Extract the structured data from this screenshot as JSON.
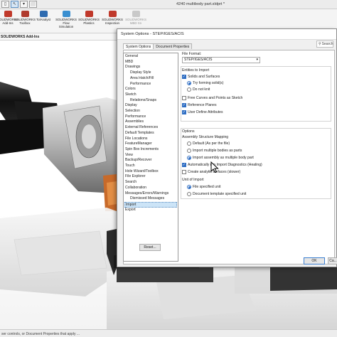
{
  "window": {
    "title": "4240 multibody part.sldprt *"
  },
  "toolbar": {
    "buttons": [
      "▯",
      "↖",
      "▾",
      "⬜"
    ]
  },
  "ribbon": {
    "items": [
      {
        "label": "SOLIDWORKS\nAdd-Ins",
        "color": "#c0392b"
      },
      {
        "label": "SOLIDWORKS\nToolbox",
        "color": "#b03a2e"
      },
      {
        "label": "TolAnalyst",
        "color": "#2e6bb0"
      },
      {
        "label": "SOLIDWORKS\nFlow\nSimulation",
        "color": "#3a8fd0"
      },
      {
        "label": "SOLIDWORKS\nPlastics",
        "color": "#c0392b"
      },
      {
        "label": "SOLIDWORKS\nInspection",
        "color": "#c0392b"
      },
      {
        "label": "SOLIDWORKS\nMBD Sn",
        "color": "#b5b5b5"
      }
    ]
  },
  "command_tab": {
    "label": "SOLIDWORKS Add-Ins"
  },
  "status_bar": {
    "text": "ser controls, or Document Properties that apply ..."
  },
  "dialog": {
    "title": "System Options - STEP/IGES/ACIS",
    "tabs": [
      "System Options",
      "Document Properties"
    ],
    "search_label": "Search",
    "categories": [
      {
        "label": "General",
        "level": 1
      },
      {
        "label": "MBD",
        "level": 1
      },
      {
        "label": "Drawings",
        "level": 1
      },
      {
        "label": "Display Style",
        "level": 2
      },
      {
        "label": "Area Hatch/Fill",
        "level": 2
      },
      {
        "label": "Performance",
        "level": 2
      },
      {
        "label": "Colors",
        "level": 1
      },
      {
        "label": "Sketch",
        "level": 1
      },
      {
        "label": "Relations/Snaps",
        "level": 2
      },
      {
        "label": "Display",
        "level": 1
      },
      {
        "label": "Selection",
        "level": 1
      },
      {
        "label": "Performance",
        "level": 1
      },
      {
        "label": "Assemblies",
        "level": 1
      },
      {
        "label": "External References",
        "level": 1
      },
      {
        "label": "Default Templates",
        "level": 1
      },
      {
        "label": "File Locations",
        "level": 1
      },
      {
        "label": "FeatureManager",
        "level": 1
      },
      {
        "label": "Spin Box Increments",
        "level": 1
      },
      {
        "label": "View",
        "level": 1
      },
      {
        "label": "Backup/Recover",
        "level": 1
      },
      {
        "label": "Touch",
        "level": 1
      },
      {
        "label": "Hole Wizard/Toolbox",
        "level": 1
      },
      {
        "label": "File Explorer",
        "level": 1
      },
      {
        "label": "Search",
        "level": 1
      },
      {
        "label": "Collaboration",
        "level": 1
      },
      {
        "label": "Messages/Errors/Warnings",
        "level": 1
      },
      {
        "label": "Dismissed Messages",
        "level": 2
      },
      {
        "label": "Import",
        "level": 1
      },
      {
        "label": "Export",
        "level": 1
      }
    ],
    "reset_label": "Reset...",
    "file_format_label": "File Format:",
    "file_format_value": "STEP/IGES/ACIS",
    "entities_group": {
      "title": "Entities to Import",
      "items": [
        {
          "label": "Solids and Surfaces",
          "type": "checkbox",
          "checked": true
        },
        {
          "label": "Try forming solid(s)",
          "type": "radio",
          "checked": true
        },
        {
          "label": "Do not knit",
          "type": "radio",
          "checked": false
        },
        {
          "label": "Free Curves and Points as Sketch",
          "type": "checkbox",
          "checked": false
        },
        {
          "label": "Reference Planes",
          "type": "checkbox",
          "checked": true
        },
        {
          "label": "User Define Attributes",
          "type": "checkbox",
          "checked": true
        }
      ]
    },
    "options_group": {
      "title": "Options",
      "assembly_mapping_label": "Assembly Structure Mapping",
      "mapping_items": [
        {
          "label": "Default (As per the file)",
          "checked": false
        },
        {
          "label": "Import multiple bodies as parts",
          "checked": false
        },
        {
          "label": "Import assembly as multiple body part",
          "checked": true
        }
      ],
      "check_items": [
        {
          "label": "Automatically run Import Diagnostics (Healing)",
          "checked": true
        },
        {
          "label": "Create analytic surfaces (slower)",
          "checked": false
        }
      ],
      "unit_label": "Unit of Import",
      "unit_items": [
        {
          "label": "File specified unit",
          "checked": true
        },
        {
          "label": "Document template specified unit",
          "checked": false
        }
      ]
    },
    "ok_label": "OK",
    "cancel_label": "Ca..."
  }
}
